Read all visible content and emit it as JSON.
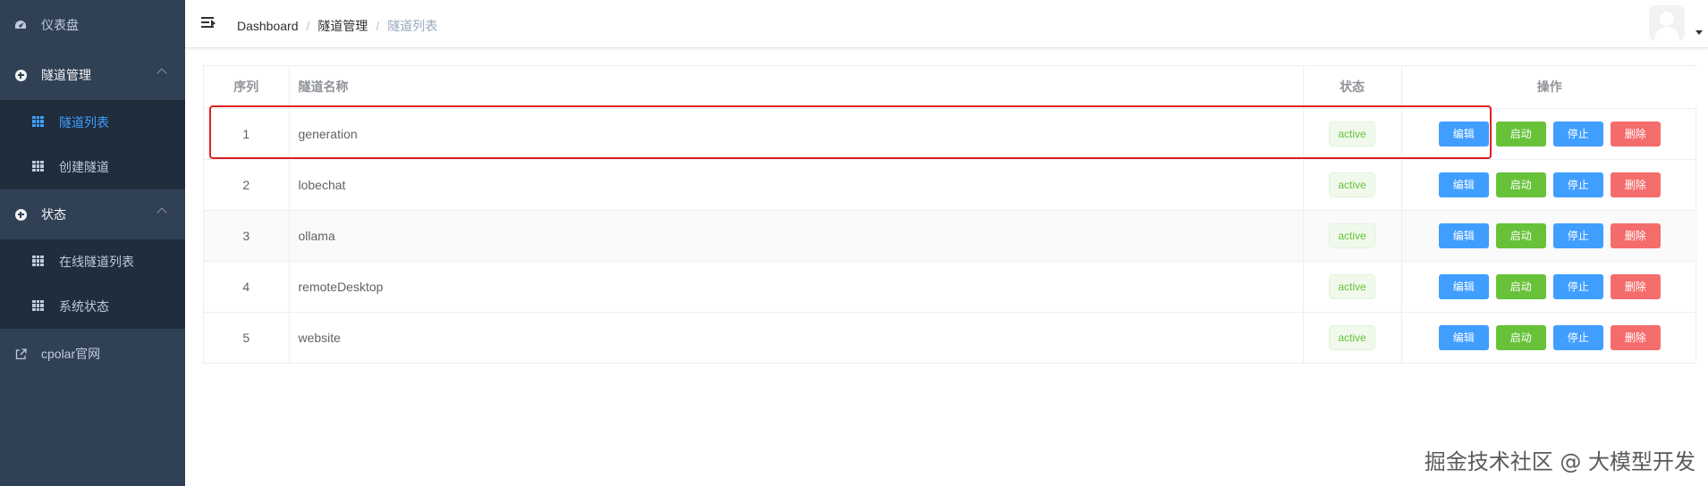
{
  "sidebar": {
    "dashboard": "仪表盘",
    "tunnel_mgmt": "隧道管理",
    "tunnel_list": "隧道列表",
    "create_tunnel": "创建隧道",
    "status": "状态",
    "online_tunnels": "在线隧道列表",
    "system_status": "系统状态",
    "cpolar_site": "cpolar官网"
  },
  "breadcrumb": {
    "home": "Dashboard",
    "sep": "/",
    "parent": "隧道管理",
    "current": "隧道列表"
  },
  "table": {
    "headers": {
      "index": "序列",
      "name": "隧道名称",
      "status": "状态",
      "actions": "操作"
    },
    "rows": [
      {
        "index": "1",
        "name": "generation",
        "status": "active"
      },
      {
        "index": "2",
        "name": "lobechat",
        "status": "active"
      },
      {
        "index": "3",
        "name": "ollama",
        "status": "active"
      },
      {
        "index": "4",
        "name": "remoteDesktop",
        "status": "active"
      },
      {
        "index": "5",
        "name": "website",
        "status": "active"
      }
    ],
    "buttons": {
      "edit": "编辑",
      "start": "启动",
      "stop": "停止",
      "delete": "删除"
    }
  },
  "watermark": "掘金技术社区 @ 大模型开发",
  "colors": {
    "sidebar_bg": "#304156",
    "submenu_bg": "#1f2d3d",
    "active_menu": "#409eff",
    "primary": "#409eff",
    "success": "#67c23a",
    "danger": "#f56c6c",
    "highlight": "#e02020"
  }
}
